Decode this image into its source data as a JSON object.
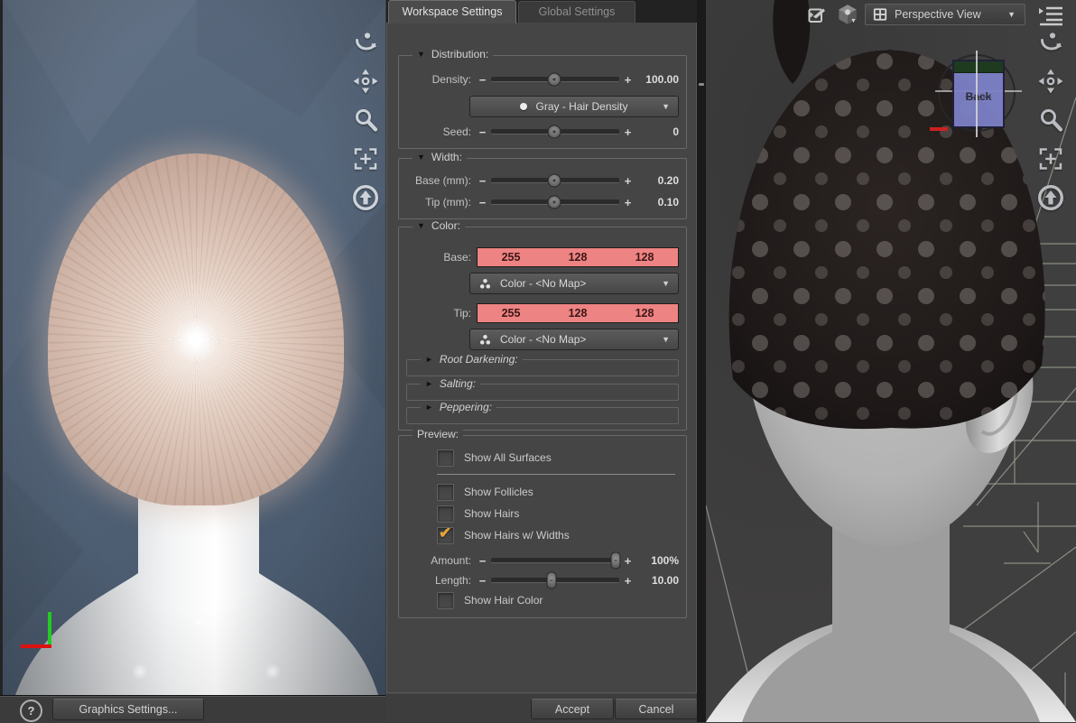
{
  "ui": {
    "minus": "−",
    "plus": "+",
    "dropdown_arrow": "▼",
    "open_arrow": "▼",
    "closed_arrow": "►",
    "check": "✔",
    "help": "?"
  },
  "tabs": {
    "workspace": "Workspace Settings",
    "global": "Global Settings"
  },
  "panel": {
    "distribution": {
      "title": "Distribution:",
      "density_label": "Density:",
      "density_value": "100.00",
      "density_map": "Gray - Hair Density",
      "seed_label": "Seed:",
      "seed_value": "0"
    },
    "width": {
      "title": "Width:",
      "base_label": "Base (mm):",
      "base_value": "0.20",
      "tip_label": "Tip (mm):",
      "tip_value": "0.10"
    },
    "color": {
      "title": "Color:",
      "base_label": "Base:",
      "tip_label": "Tip:",
      "base_rgb": [
        "255",
        "128",
        "128"
      ],
      "tip_rgb": [
        "255",
        "128",
        "128"
      ],
      "base_map": "Color - <No Map>",
      "tip_map": "Color - <No Map>",
      "root_darkening_title": "Root Darkening:",
      "salting_title": "Salting:",
      "peppering_title": "Peppering:"
    },
    "preview": {
      "title": "Preview:",
      "show_all_surfaces": "Show All Surfaces",
      "show_follicles": "Show Follicles",
      "show_hairs": "Show Hairs",
      "show_hairs_w_widths": "Show Hairs w/ Widths",
      "amount_label": "Amount:",
      "amount_value": "100%",
      "length_label": "Length:",
      "length_value": "10.00",
      "show_hair_color": "Show Hair Color"
    },
    "buttons": {
      "accept": "Accept",
      "cancel": "Cancel"
    }
  },
  "left_viewport": {
    "graphics_settings": "Graphics Settings..."
  },
  "right_viewport": {
    "camera_view": "Perspective View",
    "view_cube_face": "Back"
  },
  "colors": {
    "swatch": "#ee8383",
    "check_accent": "#e7a33b",
    "panel_bg": "#454545",
    "left_viewport_bg": "#57677b",
    "right_viewport_bg": "#403f3f",
    "cube_face": "#7c81c6"
  }
}
